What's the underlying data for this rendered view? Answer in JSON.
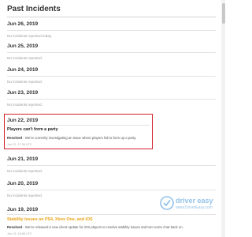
{
  "header": {
    "title": "Past Incidents"
  },
  "days": [
    {
      "date": "Jun 26, 2019",
      "status": "No incidents reported today."
    },
    {
      "date": "Jun 25, 2019",
      "status": "No incidents reported."
    },
    {
      "date": "Jun 24, 2019",
      "status": "No incidents reported."
    },
    {
      "date": "Jun 23, 2019",
      "status": "No incidents reported."
    }
  ],
  "highlighted_incident": {
    "date": "Jun 22, 2019",
    "title": "Players can't form a party",
    "status": "Resolved",
    "body": " - We're currently investigating an issue where players fail to form up a party.",
    "time": "Jun 22, 17:36 UTC"
  },
  "days_after": [
    {
      "date": "Jun 21, 2019",
      "status": "No incidents reported."
    },
    {
      "date": "Jun 20, 2019",
      "status": "No incidents reported."
    }
  ],
  "last_incident": {
    "date": "Jun 19, 2019",
    "title": "Stability Issues on PS4, Xbox One, and iOS",
    "status": "Resolved",
    "body": " - We've released a new client update for iOS players to resolve stability issues and turn voice chat back on.",
    "time": "Jun 19, 18:58 UTC"
  },
  "watermark": {
    "name": "driver easy",
    "url": "www.DriverEasy.com"
  },
  "colors": {
    "highlight": "#d0232b",
    "incident_yellow": "#e8a319",
    "watermark_blue": "#3a8fd8"
  }
}
